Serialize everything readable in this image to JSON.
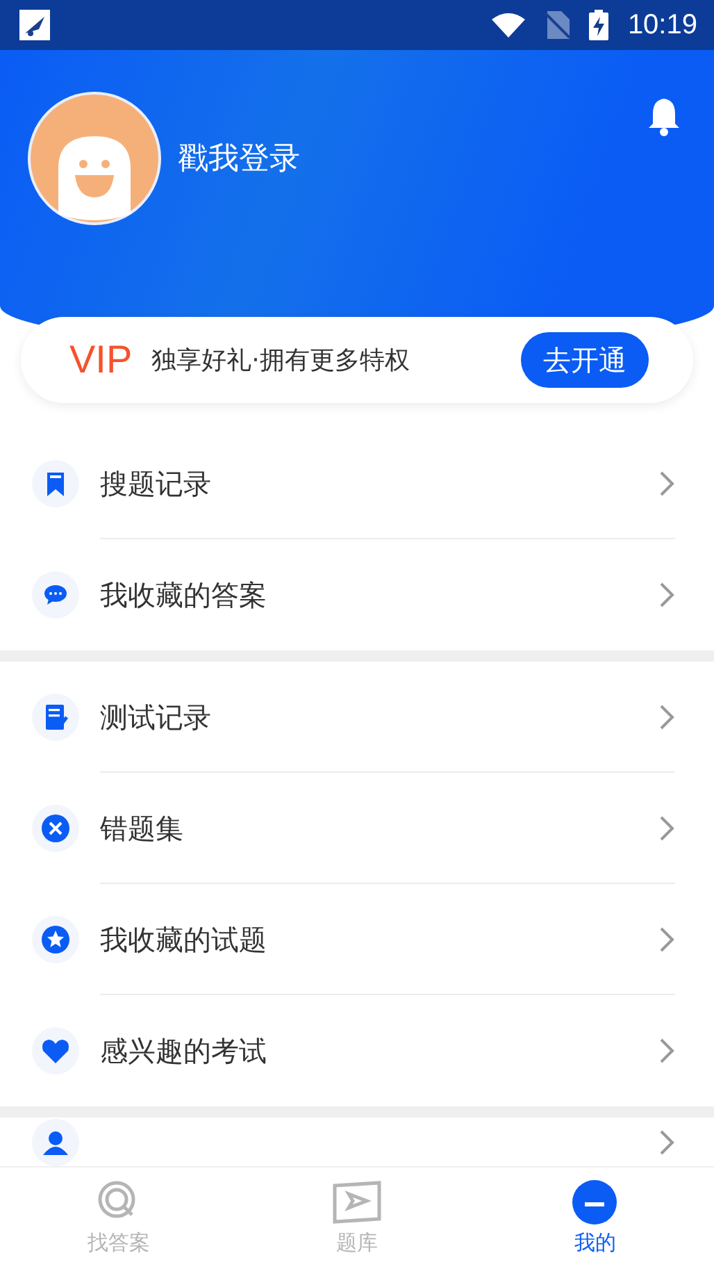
{
  "status_bar": {
    "time": "10:19"
  },
  "profile": {
    "login_prompt": "戳我登录"
  },
  "vip_card": {
    "badge": "VIP",
    "slogan": "独享好礼·拥有更多特权",
    "button": "去开通"
  },
  "menu_groups": [
    {
      "items": [
        {
          "label": "搜题记录"
        },
        {
          "label": "我收藏的答案"
        }
      ]
    },
    {
      "items": [
        {
          "label": "测试记录"
        },
        {
          "label": "错题集"
        },
        {
          "label": "我收藏的试题"
        },
        {
          "label": "感兴趣的考试"
        }
      ]
    }
  ],
  "tabs": [
    {
      "label": "找答案",
      "selected": false
    },
    {
      "label": "题库",
      "selected": false
    },
    {
      "label": "我的",
      "selected": true
    }
  ]
}
